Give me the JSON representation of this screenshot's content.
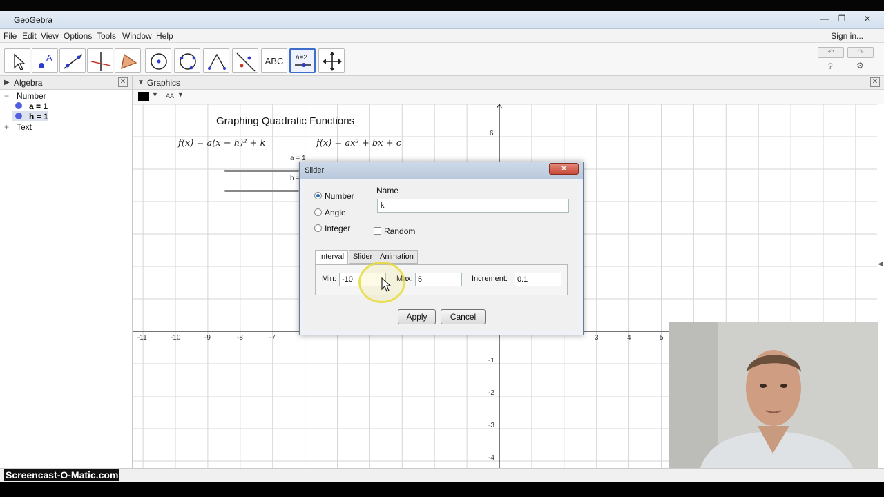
{
  "window": {
    "title": "GeoGebra",
    "controls": [
      "—",
      "❐",
      "✕"
    ]
  },
  "menu": {
    "items": [
      "File",
      "Edit",
      "View",
      "Options",
      "Tools",
      "Window",
      "Help"
    ],
    "signin": "Sign in..."
  },
  "toolbar": {
    "tools": [
      "move-tool",
      "point-tool",
      "line-tool",
      "perpendicular-line-tool",
      "polygon-tool",
      "circle-tool",
      "circle-through-points-tool",
      "angle-tool",
      "reflect-tool",
      "text-tool",
      "slider-tool",
      "move-graphics-tool"
    ],
    "text_tool_label": "ABC",
    "slider_tool_label": "a = 2",
    "undo": "↶",
    "redo": "↷",
    "help": "?",
    "settings": "⚙"
  },
  "algebra": {
    "title": "Algebra",
    "group_number": "Number",
    "items": [
      "a = 1",
      "h = 1"
    ],
    "group_text": "Text"
  },
  "graphics": {
    "title": "Graphics",
    "style_bar_font": "AA",
    "heading": "Graphing Quadratic Functions",
    "formula_vertex": "f(x) = a(x − h)² + k",
    "formula_standard": "f(x) = ax² + bx + c",
    "slider_labels": [
      "a = 1",
      "h = 1"
    ],
    "x_ticks": [
      "-11",
      "-10",
      "-9",
      "-8",
      "-7",
      "3",
      "4",
      "5"
    ],
    "y_ticks": [
      "6",
      "-1",
      "-2",
      "-3",
      "-4"
    ]
  },
  "dialog": {
    "title": "Slider",
    "close": "✕",
    "types": [
      "Number",
      "Angle",
      "Integer"
    ],
    "selected_type": "Number",
    "name_label": "Name",
    "name_value": "k",
    "random_label": "Random",
    "tabs": [
      "Interval",
      "Slider",
      "Animation"
    ],
    "selected_tab": "Interval",
    "min_label": "Min:",
    "min_value": "-10",
    "max_label": "Max:",
    "max_value": "5",
    "increment_label": "Increment:",
    "increment_value": "0.1",
    "apply": "Apply",
    "cancel": "Cancel"
  },
  "watermark": "Screencast-O-Matic.com",
  "colors": {
    "accent": "#3d6ec9",
    "dot": "#4f5fe0",
    "dialog_close": "#c74a37",
    "highlight": "#e8dc3c"
  }
}
